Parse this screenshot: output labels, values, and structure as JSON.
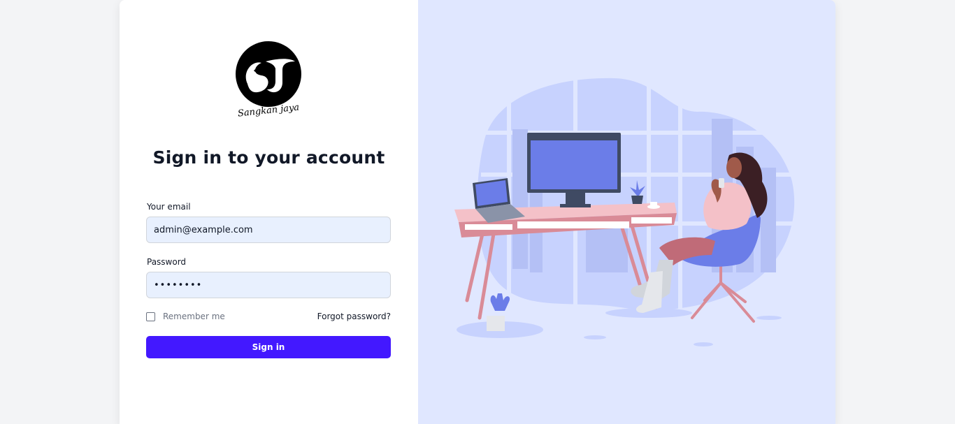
{
  "brand": {
    "logo_icon": "sangkan-jaya-logo-icon",
    "logo_text": "Sangkan jaya"
  },
  "login": {
    "title": "Sign in to your account",
    "email_label": "Your email",
    "email_value": "admin@example.com",
    "password_label": "Password",
    "password_value": "••••••••",
    "remember_label": "Remember me",
    "remember_checked": false,
    "forgot_label": "Forgot password?",
    "submit_label": "Sign in"
  },
  "illustration": {
    "icon": "office-desk-illustration"
  },
  "colors": {
    "page_bg": "#f3f4f6",
    "panel_bg": "#e0e7ff",
    "accent": "#4318ff",
    "input_bg": "#e8f0fe"
  }
}
